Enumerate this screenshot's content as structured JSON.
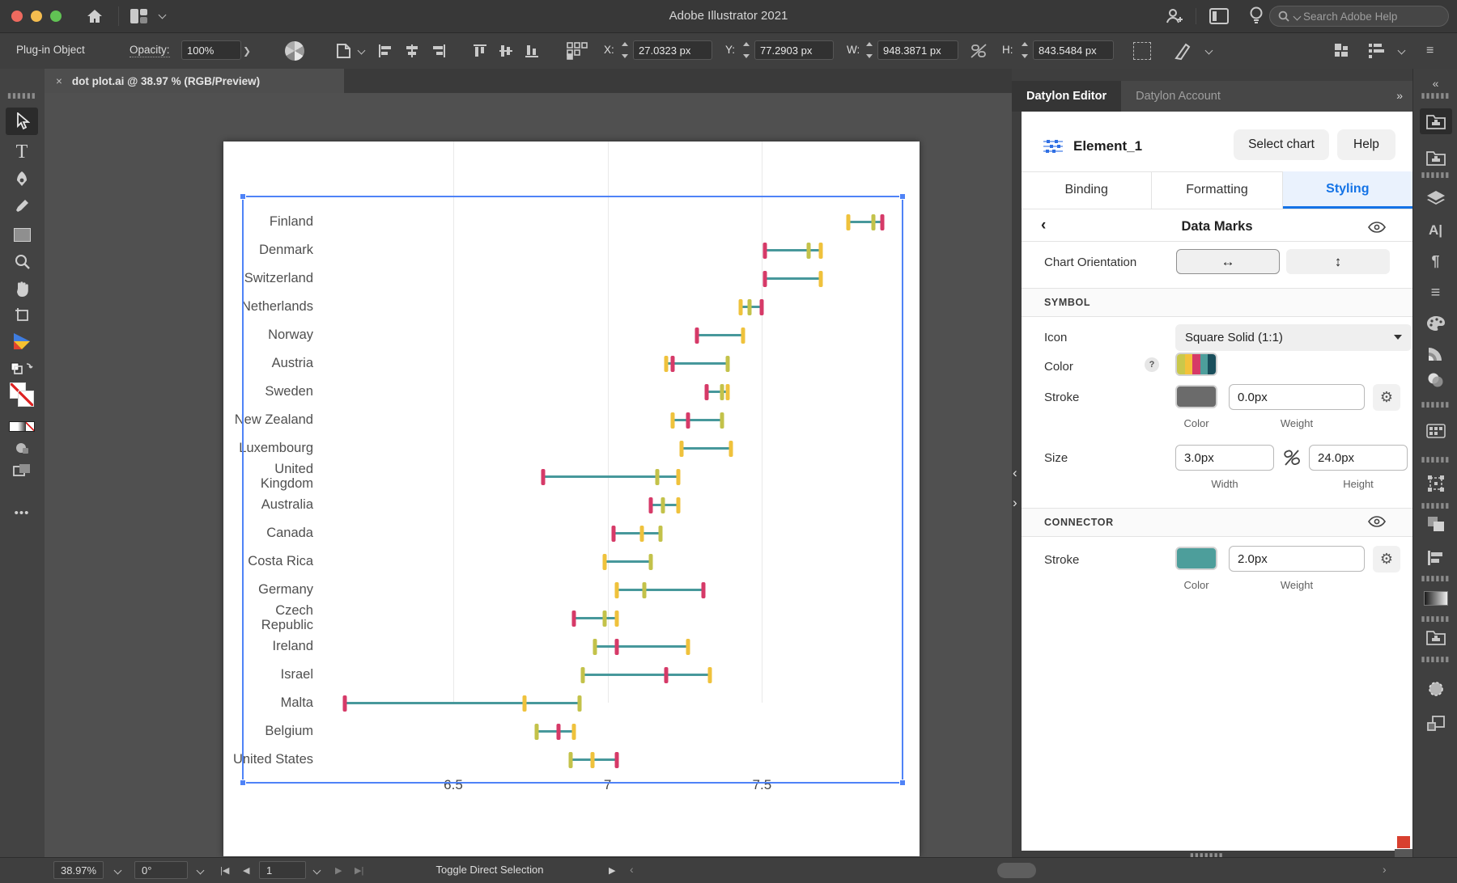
{
  "titlebar": {
    "title": "Adobe Illustrator 2021",
    "search_placeholder": "Search Adobe Help"
  },
  "controlbar": {
    "selection_label": "Plug-in Object",
    "opacity_label": "Opacity:",
    "opacity_value": "100%",
    "x_label": "X:",
    "x_value": "27.0323 px",
    "y_label": "Y:",
    "y_value": "77.2903 px",
    "w_label": "W:",
    "w_value": "948.3871 px",
    "h_label": "H:",
    "h_value": "843.5484 px"
  },
  "doc_tab": {
    "close": "×",
    "title": "dot plot.ai @ 38.97 % (RGB/Preview)"
  },
  "tools": [
    {
      "name": "toolbar-grip",
      "glyph": "grip"
    },
    {
      "name": "selection-tool",
      "glyph": "arrow",
      "active": true
    },
    {
      "name": "type-tool",
      "glyph": "type"
    },
    {
      "name": "pen-tool",
      "glyph": "pen"
    },
    {
      "name": "eyedropper-tool",
      "glyph": "eyedropper"
    },
    {
      "name": "rectangle-tool",
      "glyph": "rect"
    },
    {
      "name": "zoom-tool",
      "glyph": "zoom"
    },
    {
      "name": "hand-tool",
      "glyph": "hand"
    },
    {
      "name": "artboard-tool",
      "glyph": "artboard"
    },
    {
      "name": "datylon-tool",
      "glyph": "datylon"
    },
    {
      "name": "swap-fill-stroke-icon",
      "glyph": "swap"
    },
    {
      "name": "fill-stroke-indicator",
      "glyph": "fillstroke"
    },
    {
      "name": "color-mode-bar",
      "glyph": "colorbar"
    },
    {
      "name": "draw-mode-icon",
      "glyph": "drawmode"
    },
    {
      "name": "screen-mode-icon",
      "glyph": "screenmode"
    },
    {
      "name": "more-tools-icon",
      "glyph": "dots"
    }
  ],
  "right_strip": [
    {
      "name": "collapse-panels-icon",
      "glyph": "laquo"
    },
    {
      "name": "panel-grip",
      "glyph": "grip"
    },
    {
      "name": "libraries-panel-icon",
      "glyph": "folder",
      "active": true
    },
    {
      "name": "libraries2-panel-icon",
      "glyph": "folder"
    },
    {
      "name": "panel-grip",
      "glyph": "grip"
    },
    {
      "name": "layers-panel-icon",
      "glyph": "layers"
    },
    {
      "name": "character-panel-icon",
      "glyph": "character"
    },
    {
      "name": "paragraph-panel-icon",
      "glyph": "paragraph"
    },
    {
      "name": "stroke-panel-icon",
      "glyph": "lines"
    },
    {
      "name": "color-panel-icon",
      "glyph": "palette"
    },
    {
      "name": "color-guide-panel-icon",
      "glyph": "fan"
    },
    {
      "name": "transparency-panel-icon",
      "glyph": "transparency"
    },
    {
      "name": "panel-grip",
      "glyph": "grip"
    },
    {
      "name": "swatches-panel-icon",
      "glyph": "swatches"
    },
    {
      "name": "panel-grip",
      "glyph": "grip"
    },
    {
      "name": "transform-panel-icon",
      "glyph": "transform"
    },
    {
      "name": "panel-grip",
      "glyph": "grip"
    },
    {
      "name": "pathfinder-panel-icon",
      "glyph": "pathfinder"
    },
    {
      "name": "align-panel-icon",
      "glyph": "align"
    },
    {
      "name": "panel-grip",
      "glyph": "grip"
    },
    {
      "name": "gradient-panel-icon",
      "glyph": "gradient"
    },
    {
      "name": "panel-grip",
      "glyph": "grip"
    },
    {
      "name": "libraries3-panel-icon",
      "glyph": "folder"
    },
    {
      "name": "panel-grip",
      "glyph": "grip"
    },
    {
      "name": "magic-wand-panel-icon",
      "glyph": "dashedcircle"
    },
    {
      "name": "artboards-panel-icon",
      "glyph": "artboards"
    }
  ],
  "panel": {
    "tab_editor": "Datylon Editor",
    "tab_account": "Datylon Account",
    "collapse": "»",
    "element_name": "Element_1",
    "select_chart": "Select chart",
    "help": "Help",
    "tabs": [
      "Binding",
      "Formatting",
      "Styling"
    ],
    "active_tab": "Styling",
    "section_title": "Data Marks",
    "chart_orientation_label": "Chart Orientation",
    "orientation_horizontal": "↔",
    "orientation_vertical": "↕",
    "symbol": {
      "header": "SYMBOL",
      "icon_label": "Icon",
      "icon_value": "Square Solid (1:1)",
      "color_label": "Color",
      "help_badge": "?",
      "stroke_label": "Stroke",
      "stroke_weight": "0.0px",
      "color_sub": "Color",
      "weight_sub": "Weight",
      "size_label": "Size",
      "width_value": "3.0px",
      "height_value": "24.0px",
      "width_sub": "Width",
      "height_sub": "Height",
      "stroke_swatch_color": "#6b6b6b",
      "palette": [
        "#c9c84b",
        "#f3c13a",
        "#d63a67",
        "#4d9e9b",
        "#1a4f5c"
      ]
    },
    "connector": {
      "header": "CONNECTOR",
      "stroke_label": "Stroke",
      "weight": "2.0px",
      "color_sub": "Color",
      "weight_sub": "Weight",
      "stroke_swatch_color": "#4d9e9b"
    }
  },
  "statusbar": {
    "zoom": "38.97%",
    "rotation": "0°",
    "page": "1",
    "status": "Toggle Direct Selection"
  },
  "chart_data": {
    "type": "scatter",
    "subtype": "dumbbell-dot-plot",
    "title": "",
    "xlabel": "",
    "ylabel": "",
    "x_ticks": [
      "6.5",
      "7",
      "7.5"
    ],
    "x_tick_values": [
      6.5,
      7,
      7.5
    ],
    "x_domain": [
      6.12,
      7.95
    ],
    "grid": "vertical-only",
    "connector_color": "#47989b",
    "marker_colors": {
      "yellow": "#efc23c",
      "olive": "#c3c24a",
      "pink": "#d63a68"
    },
    "rows": [
      {
        "label": "Finland",
        "markers": [
          {
            "v": 7.78,
            "c": "yellow"
          },
          {
            "v": 7.86,
            "c": "olive"
          },
          {
            "v": 7.89,
            "c": "pink"
          }
        ]
      },
      {
        "label": "Denmark",
        "markers": [
          {
            "v": 7.51,
            "c": "pink"
          },
          {
            "v": 7.65,
            "c": "olive"
          },
          {
            "v": 7.69,
            "c": "yellow"
          }
        ]
      },
      {
        "label": "Switzerland",
        "markers": [
          {
            "v": 7.51,
            "c": "pink"
          },
          {
            "v": 7.69,
            "c": "yellow"
          }
        ]
      },
      {
        "label": "Netherlands",
        "markers": [
          {
            "v": 7.43,
            "c": "yellow"
          },
          {
            "v": 7.46,
            "c": "olive"
          },
          {
            "v": 7.5,
            "c": "pink"
          }
        ]
      },
      {
        "label": "Norway",
        "markers": [
          {
            "v": 7.29,
            "c": "pink"
          },
          {
            "v": 7.44,
            "c": "yellow"
          }
        ]
      },
      {
        "label": "Austria",
        "markers": [
          {
            "v": 7.19,
            "c": "yellow"
          },
          {
            "v": 7.21,
            "c": "pink"
          },
          {
            "v": 7.39,
            "c": "olive"
          }
        ]
      },
      {
        "label": "Sweden",
        "markers": [
          {
            "v": 7.32,
            "c": "pink"
          },
          {
            "v": 7.37,
            "c": "olive"
          },
          {
            "v": 7.39,
            "c": "yellow"
          }
        ]
      },
      {
        "label": "New Zealand",
        "markers": [
          {
            "v": 7.21,
            "c": "yellow"
          },
          {
            "v": 7.26,
            "c": "pink"
          },
          {
            "v": 7.37,
            "c": "olive"
          }
        ]
      },
      {
        "label": "Luxembourg",
        "markers": [
          {
            "v": 7.24,
            "c": "yellow"
          },
          {
            "v": 7.4,
            "c": "yellow"
          }
        ]
      },
      {
        "label": "United Kingdom",
        "markers": [
          {
            "v": 6.79,
            "c": "pink"
          },
          {
            "v": 7.16,
            "c": "olive"
          },
          {
            "v": 7.23,
            "c": "yellow"
          }
        ]
      },
      {
        "label": "Australia",
        "markers": [
          {
            "v": 7.14,
            "c": "pink"
          },
          {
            "v": 7.18,
            "c": "olive"
          },
          {
            "v": 7.23,
            "c": "yellow"
          }
        ]
      },
      {
        "label": "Canada",
        "markers": [
          {
            "v": 7.02,
            "c": "pink"
          },
          {
            "v": 7.11,
            "c": "yellow"
          },
          {
            "v": 7.17,
            "c": "olive"
          }
        ]
      },
      {
        "label": "Costa Rica",
        "markers": [
          {
            "v": 6.99,
            "c": "yellow"
          },
          {
            "v": 7.14,
            "c": "olive"
          }
        ]
      },
      {
        "label": "Germany",
        "markers": [
          {
            "v": 7.03,
            "c": "yellow"
          },
          {
            "v": 7.12,
            "c": "olive"
          },
          {
            "v": 7.31,
            "c": "pink"
          }
        ]
      },
      {
        "label": "Czech Republic",
        "markers": [
          {
            "v": 6.89,
            "c": "pink"
          },
          {
            "v": 6.99,
            "c": "olive"
          },
          {
            "v": 7.03,
            "c": "yellow"
          }
        ]
      },
      {
        "label": "Ireland",
        "markers": [
          {
            "v": 6.96,
            "c": "olive"
          },
          {
            "v": 7.03,
            "c": "pink"
          },
          {
            "v": 7.26,
            "c": "yellow"
          }
        ]
      },
      {
        "label": "Israel",
        "markers": [
          {
            "v": 6.92,
            "c": "olive"
          },
          {
            "v": 7.19,
            "c": "pink"
          },
          {
            "v": 7.33,
            "c": "yellow"
          }
        ]
      },
      {
        "label": "Malta",
        "markers": [
          {
            "v": 6.15,
            "c": "pink"
          },
          {
            "v": 6.73,
            "c": "yellow"
          },
          {
            "v": 6.91,
            "c": "olive"
          }
        ]
      },
      {
        "label": "Belgium",
        "markers": [
          {
            "v": 6.77,
            "c": "olive"
          },
          {
            "v": 6.84,
            "c": "pink"
          },
          {
            "v": 6.89,
            "c": "yellow"
          }
        ]
      },
      {
        "label": "United States",
        "markers": [
          {
            "v": 6.88,
            "c": "olive"
          },
          {
            "v": 6.95,
            "c": "yellow"
          },
          {
            "v": 7.03,
            "c": "pink"
          }
        ]
      }
    ]
  }
}
